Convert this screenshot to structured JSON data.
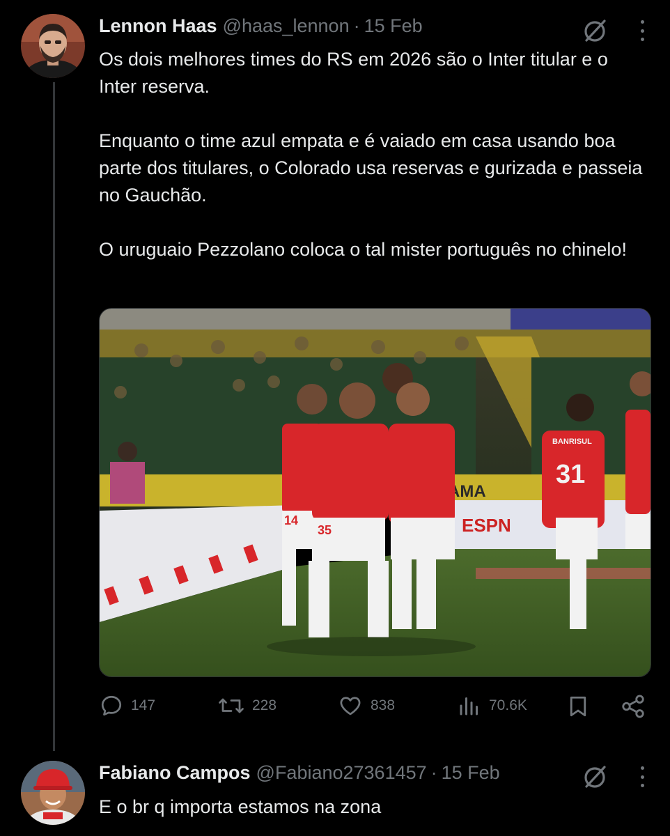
{
  "tweet": {
    "author_name": "Lennon Haas",
    "author_handle": "@haas_lennon",
    "separator": "·",
    "date": "15 Feb",
    "paragraphs": [
      "Os dois melhores times do RS em 2026 são o Inter titular e o Inter reserva.",
      "Enquanto o time azul empata e é vaiado em casa usando boa parte dos titulares, o Colorado usa reservas e gurizada e passeia no Gauchão.",
      "O uruguaio Pezzolano coloca o tal mister português no chinelo!"
    ],
    "media": {
      "description_icon": "photo-football-celebration",
      "banner_text": "BANRISUL",
      "stadium_board_text": "ESPN",
      "jersey_numbers": [
        "14",
        "35",
        "31"
      ]
    },
    "stats": {
      "replies": "147",
      "reposts": "228",
      "likes": "838",
      "views": "70.6K"
    }
  },
  "reply": {
    "author_name": "Fabiano Campos",
    "author_handle": "@Fabiano27361457",
    "separator": "·",
    "date": "15 Feb",
    "text": "E o br q importa estamos na zona"
  },
  "icons": {
    "grok": "grok-icon",
    "more": "more-icon",
    "reply": "reply-icon",
    "repost": "repost-icon",
    "like": "heart-icon",
    "views": "views-icon",
    "bookmark": "bookmark-icon",
    "share": "share-icon"
  },
  "colors": {
    "background": "#000000",
    "text": "#e7e9ea",
    "muted": "#71767b",
    "inter_red": "#d8262a"
  }
}
